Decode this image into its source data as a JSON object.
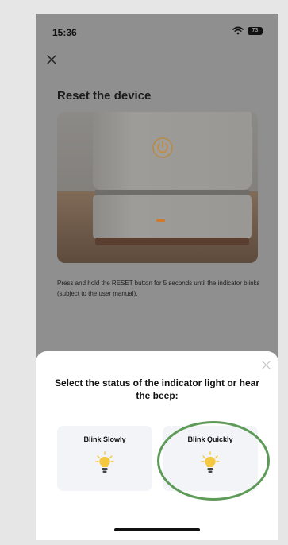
{
  "status_bar": {
    "time": "15:36",
    "battery": "73",
    "icons": [
      "wifi-icon",
      "battery-icon"
    ]
  },
  "header": {
    "close_icon": "close-icon",
    "title": "Reset the device"
  },
  "illustration": {
    "icon": "power-icon",
    "subject": "device-photo"
  },
  "instruction": "Press and hold the RESET button for 5 seconds until the indicator blinks (subject to the user manual).",
  "sheet": {
    "close_icon": "close-icon",
    "title": "Select the status of the indicator light or hear the beep:",
    "options": [
      {
        "label": "Blink Slowly",
        "icon": "lightbulb-icon"
      },
      {
        "label": "Blink Quickly",
        "icon": "lightbulb-icon",
        "highlighted": true
      }
    ]
  },
  "colors": {
    "overlay": "#8f8f8f",
    "sheet": "#ffffff",
    "option_bg": "#f3f4f8",
    "bulb": "#f5c842",
    "highlight": "#5e9a58"
  }
}
